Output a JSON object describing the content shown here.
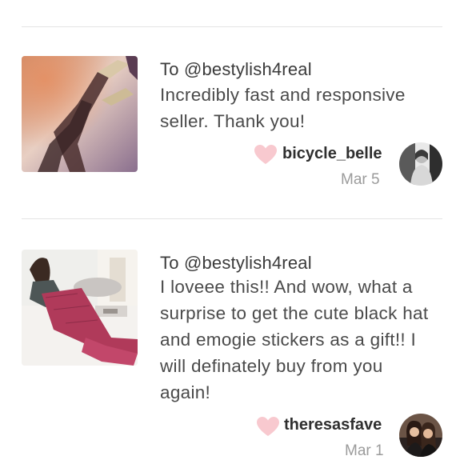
{
  "reviews": [
    {
      "to": "To @bestylish4real",
      "text": "Incredibly fast and responsive seller. Thank you!",
      "username": "bicycle_belle",
      "date": "Mar 5",
      "image_icon": "listing-photo-heels-tights",
      "avatar_icon": "user-avatar-bw"
    },
    {
      "to": "To @bestylish4real",
      "text": "I loveee this!! And wow, what a surprise to get the cute black hat and emogie stickers as a gift!! I will definately buy from you again!",
      "username": "theresasfave",
      "date": "Mar 1",
      "image_icon": "listing-photo-mermaid-blanket",
      "avatar_icon": "user-avatar-two-women"
    }
  ],
  "colors": {
    "heart": "#f8c9cf",
    "divider": "#e3e3e3",
    "date": "#9b9b9b",
    "text": "#4a4a4a"
  }
}
